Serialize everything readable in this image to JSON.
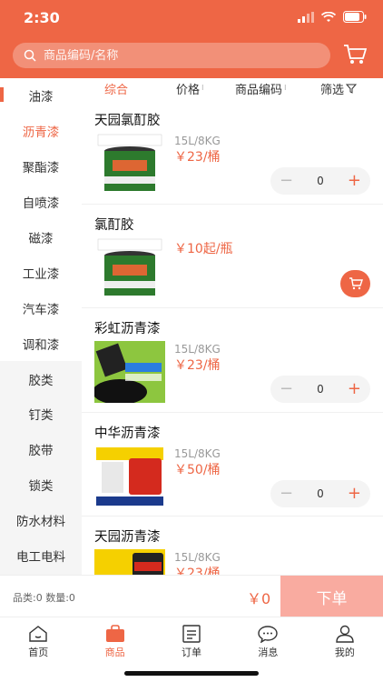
{
  "status": {
    "time": "2:30"
  },
  "search": {
    "placeholder": "商品编码/名称"
  },
  "sidebar": {
    "items": [
      {
        "label": "油漆"
      },
      {
        "label": "沥青漆"
      },
      {
        "label": "聚酯漆"
      },
      {
        "label": "自喷漆"
      },
      {
        "label": "磁漆"
      },
      {
        "label": "工业漆"
      },
      {
        "label": "汽车漆"
      },
      {
        "label": "调和漆"
      },
      {
        "label": "胶类"
      },
      {
        "label": "钉类"
      },
      {
        "label": "胶带"
      },
      {
        "label": "锁类"
      },
      {
        "label": "防水材料"
      },
      {
        "label": "电工电料"
      }
    ]
  },
  "sort": {
    "comprehensive": "综合",
    "price": "价格",
    "code": "商品编码",
    "filter": "筛选"
  },
  "products": [
    {
      "name": "天园氯酊胶",
      "spec": "15L/8KG",
      "price": "￥23/桶",
      "qty": "0"
    },
    {
      "name": "氯酊胶",
      "spec": "",
      "price": "￥10起/瓶",
      "qty": ""
    },
    {
      "name": "彩虹沥青漆",
      "spec": "15L/8KG",
      "price": "￥23/桶",
      "qty": "0"
    },
    {
      "name": "中华沥青漆",
      "spec": "15L/8KG",
      "price": "￥50/桶",
      "qty": "0"
    },
    {
      "name": "天园沥青漆",
      "spec": "15L/8KG",
      "price": "￥23/桶",
      "qty": ""
    }
  ],
  "order": {
    "summary": "品类:0 数量:0",
    "total": "￥0",
    "submit": "下单"
  },
  "tabs": [
    {
      "label": "首页"
    },
    {
      "label": "商品"
    },
    {
      "label": "订单"
    },
    {
      "label": "消息"
    },
    {
      "label": "我的"
    }
  ],
  "colors": {
    "accent": "#ee6645",
    "order_button": "#f9aba0"
  }
}
